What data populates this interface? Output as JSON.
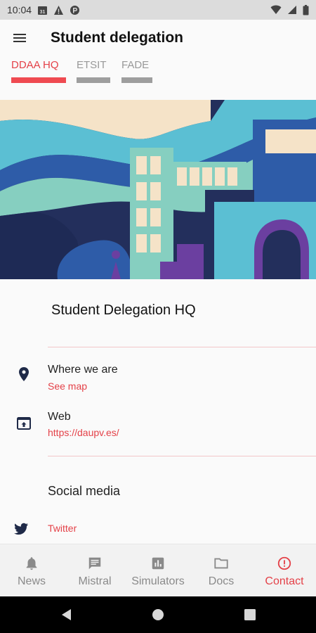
{
  "status_bar": {
    "time": "10:04",
    "calendar_day": "31"
  },
  "app_bar": {
    "title": "Student delegation"
  },
  "tabs": [
    {
      "label": "DDAA HQ",
      "active": true
    },
    {
      "label": "ETSIT",
      "active": false
    },
    {
      "label": "FADE",
      "active": false
    }
  ],
  "content": {
    "heading": "Student Delegation HQ",
    "location": {
      "label": "Where we are",
      "link": "See map",
      "icon": "location-pin-icon"
    },
    "web": {
      "label": "Web",
      "link": "https://daupv.es/",
      "icon": "open-in-browser-icon"
    },
    "social_title": "Social media",
    "twitter": {
      "label": "Twitter",
      "icon": "twitter-icon"
    }
  },
  "bottom_nav": [
    {
      "label": "News",
      "icon": "bell-icon",
      "active": false
    },
    {
      "label": "Mistral",
      "icon": "chat-icon",
      "active": false
    },
    {
      "label": "Simulators",
      "icon": "chart-icon",
      "active": false
    },
    {
      "label": "Docs",
      "icon": "folder-icon",
      "active": false
    },
    {
      "label": "Contact",
      "icon": "info-icon",
      "active": true
    }
  ],
  "colors": {
    "accent": "#e44148",
    "hero_navy": "#232f5c",
    "hero_teal": "#86cfc0",
    "hero_cream": "#f5e3c8",
    "hero_blue": "#2e5ca8",
    "hero_cyan": "#5bbfd3",
    "hero_purple": "#6b3fa0"
  }
}
